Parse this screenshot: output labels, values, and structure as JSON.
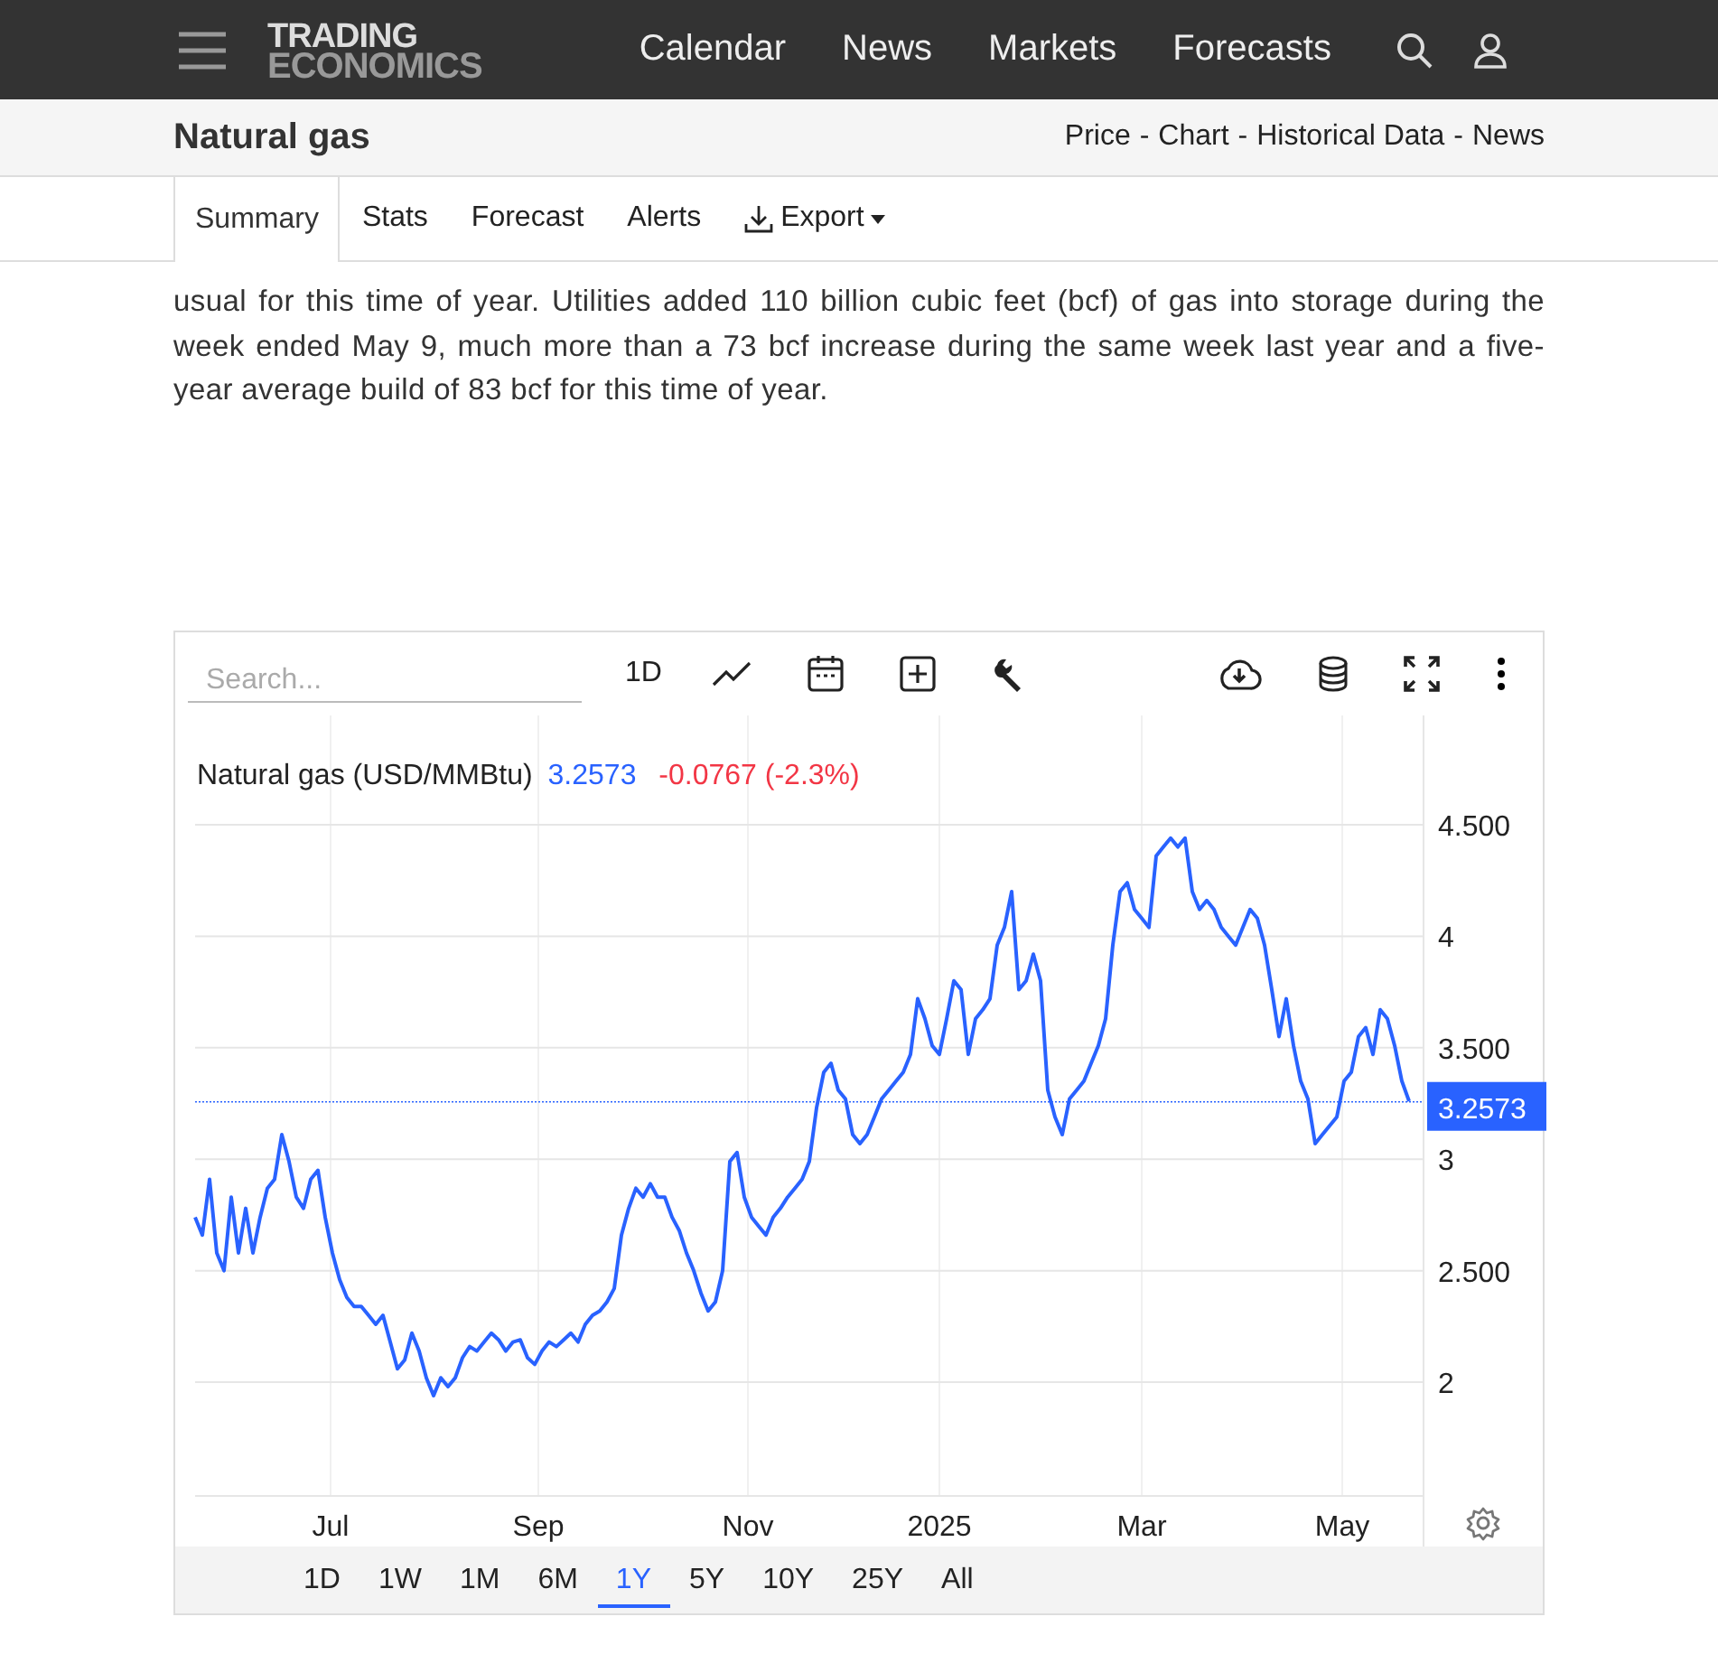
{
  "header": {
    "logo_top": "TRADING",
    "logo_bottom": "ECONOMICS",
    "nav": [
      "Calendar",
      "News",
      "Markets",
      "Forecasts"
    ]
  },
  "subheader": {
    "title": "Natural gas",
    "links": [
      "Price",
      "Chart",
      "Historical Data",
      "News"
    ],
    "separator": "-"
  },
  "tabs": [
    {
      "label": "Summary",
      "selected": true
    },
    {
      "label": "Stats",
      "selected": false
    },
    {
      "label": "Forecast",
      "selected": false
    },
    {
      "label": "Alerts",
      "selected": false
    },
    {
      "label": "Export",
      "selected": false,
      "kind": "dropdown"
    }
  ],
  "paragraph": "usual for this time of year. Utilities added 110 billion cubic feet (bcf) of gas into storage during the week ended May 9, much more than a 73 bcf increase during the same week last year and a five-year average build of 83 bcf for this time of year.",
  "chart_toolbar": {
    "search_placeholder": "Search...",
    "interval": "1D"
  },
  "chart": {
    "legend": {
      "price": "3.2573",
      "change": "-0.0767 (-2.3%)"
    },
    "price_tag": "3.2573",
    "x_axis_labels": [
      "Jul",
      "Sep",
      "Nov",
      "2025",
      "Mar",
      "May"
    ],
    "chart_data": {
      "type": "line",
      "ylim": [
        1.49,
        4.99
      ],
      "grid": true,
      "ref_lines": [
        {
          "axis": "y",
          "value": 3.2573,
          "color": "#2962ff"
        }
      ],
      "yticks": [
        {
          "value": 2,
          "label": "2"
        },
        {
          "value": 2.5,
          "label": "2.500"
        },
        {
          "value": 3,
          "label": "3"
        },
        {
          "value": 3.5,
          "label": "3.500"
        },
        {
          "value": 4,
          "label": "4"
        },
        {
          "value": 4.5,
          "label": "4.500"
        }
      ],
      "series": [
        {
          "name": "Natural gas (USD/MMBtu)",
          "color": "#2962ff",
          "values": [
            2.74,
            2.66,
            2.91,
            2.58,
            2.5,
            2.83,
            2.58,
            2.78,
            2.58,
            2.74,
            2.87,
            2.91,
            3.11,
            2.99,
            2.83,
            2.78,
            2.91,
            2.95,
            2.74,
            2.58,
            2.46,
            2.38,
            2.34,
            2.34,
            2.3,
            2.26,
            2.3,
            2.18,
            2.06,
            2.1,
            2.22,
            2.14,
            2.02,
            1.94,
            2.02,
            1.98,
            2.02,
            2.11,
            2.16,
            2.14,
            2.18,
            2.22,
            2.19,
            2.14,
            2.18,
            2.19,
            2.11,
            2.08,
            2.14,
            2.18,
            2.16,
            2.19,
            2.22,
            2.18,
            2.26,
            2.3,
            2.32,
            2.36,
            2.42,
            2.66,
            2.78,
            2.87,
            2.83,
            2.89,
            2.83,
            2.83,
            2.74,
            2.68,
            2.58,
            2.5,
            2.4,
            2.32,
            2.36,
            2.5,
            2.99,
            3.03,
            2.83,
            2.74,
            2.7,
            2.66,
            2.74,
            2.78,
            2.83,
            2.87,
            2.91,
            2.99,
            3.23,
            3.39,
            3.43,
            3.31,
            3.27,
            3.11,
            3.07,
            3.11,
            3.19,
            3.27,
            3.31,
            3.35,
            3.39,
            3.47,
            3.72,
            3.63,
            3.51,
            3.47,
            3.63,
            3.8,
            3.76,
            3.47,
            3.63,
            3.67,
            3.72,
            3.96,
            4.04,
            4.2,
            3.76,
            3.8,
            3.92,
            3.8,
            3.31,
            3.19,
            3.11,
            3.27,
            3.31,
            3.35,
            3.43,
            3.51,
            3.63,
            3.96,
            4.2,
            4.24,
            4.12,
            4.08,
            4.04,
            4.36,
            4.4,
            4.44,
            4.4,
            4.44,
            4.2,
            4.12,
            4.16,
            4.12,
            4.04,
            4.0,
            3.96,
            4.04,
            4.12,
            4.08,
            3.96,
            3.76,
            3.55,
            3.72,
            3.51,
            3.35,
            3.27,
            3.07,
            3.11,
            3.15,
            3.19,
            3.35,
            3.39,
            3.55,
            3.59,
            3.47,
            3.67,
            3.63,
            3.51,
            3.35,
            3.26
          ]
        }
      ]
    }
  },
  "ranges": [
    {
      "label": "1D",
      "selected": false
    },
    {
      "label": "1W",
      "selected": false
    },
    {
      "label": "1M",
      "selected": false
    },
    {
      "label": "6M",
      "selected": false
    },
    {
      "label": "1Y",
      "selected": true
    },
    {
      "label": "5Y",
      "selected": false
    },
    {
      "label": "10Y",
      "selected": false
    },
    {
      "label": "25Y",
      "selected": false
    },
    {
      "label": "All",
      "selected": false
    }
  ]
}
